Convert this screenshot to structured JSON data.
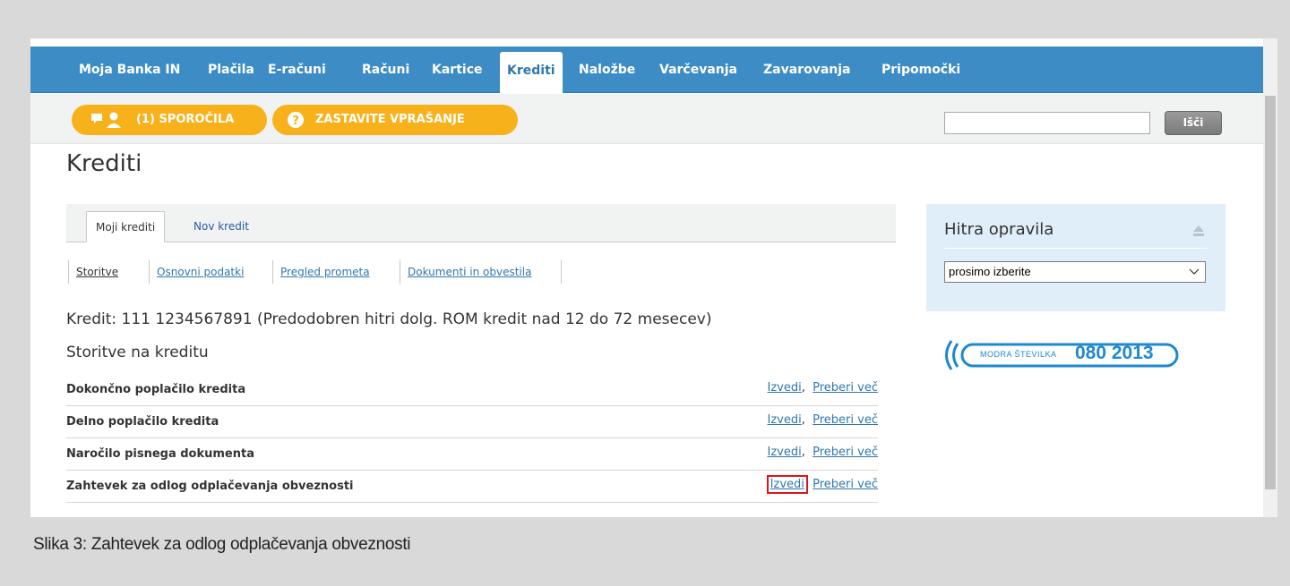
{
  "nav": {
    "items": [
      "Moja Banka IN",
      "Plačila",
      "E-računi",
      "Računi",
      "Kartice",
      "Krediti",
      "Naložbe",
      "Varčevanja",
      "Zavarovanja",
      "Pripomočki"
    ],
    "active": "Krediti"
  },
  "toolbar": {
    "messages_label": "(1) SPOROČILA",
    "ask_label": "ZASTAVITE VPRAŠANJE",
    "search_value": "",
    "search_button": "Išči"
  },
  "page": {
    "title": "Krediti"
  },
  "tabs": [
    {
      "label": "Moji krediti",
      "active": true
    },
    {
      "label": "Nov kredit",
      "active": false
    }
  ],
  "sublinks": [
    {
      "label": "Storitve",
      "active": true
    },
    {
      "label": "Osnovni podatki",
      "active": false
    },
    {
      "label": "Pregled prometa",
      "active": false
    },
    {
      "label": "Dokumenti in obvestila",
      "active": false
    }
  ],
  "credit": {
    "line": "Kredit: 111 1234567891 (Predodobren hitri dolg. ROM kredit nad 12 do 72 mesecev)",
    "section_title": "Storitve na kreditu"
  },
  "services": [
    {
      "label": "Dokončno poplačilo kredita",
      "action": "Izvedi",
      "more": "Preberi več",
      "highlighted": false
    },
    {
      "label": "Delno poplačilo kredita",
      "action": "Izvedi",
      "more": "Preberi več",
      "highlighted": false
    },
    {
      "label": "Naročilo pisnega dokumenta",
      "action": "Izvedi",
      "more": "Preberi več",
      "highlighted": false
    },
    {
      "label": "Zahtevek za odlog odplačevanja obveznosti",
      "action": "Izvedi",
      "more": "Preberi več",
      "highlighted": true
    }
  ],
  "quick_tasks": {
    "title": "Hitra opravila",
    "select_value": "prosimo izberite"
  },
  "hotline": {
    "label": "MODRA ŠTEVILKA",
    "number": "080 2013"
  },
  "caption": "Slika 3: Zahtevek za odlog odplačevanja obveznosti",
  "colors": {
    "nav_blue": "#3d8cc6",
    "accent_orange": "#f7b21b",
    "link_blue": "#2f78ad",
    "highlight_red": "#e0121a",
    "panel_blue": "#dfeef9"
  }
}
